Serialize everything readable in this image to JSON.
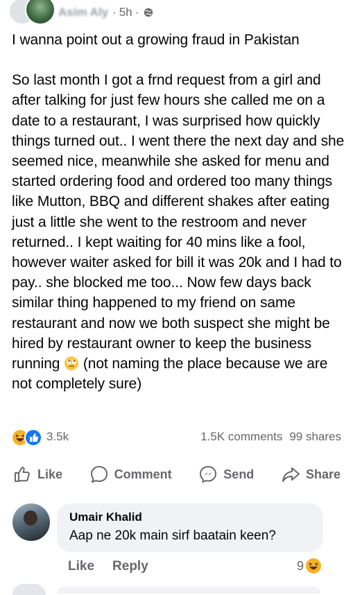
{
  "post": {
    "author": "Asim Aly",
    "time": "5h",
    "separator": "·",
    "paragraphs": [
      "I wanna point out a growing fraud in Pakistan",
      "So last month I got a frnd request from a girl and after talking for just few hours she called me on a date to a restaurant, I was surprised how quickly things turned out.. I went there the next day and she seemed nice, meanwhile she asked for menu and started ordering food and ordered too many things like Mutton, BBQ and different shakes after eating just a little she went to the restroom and never returned.. I kept waiting for 40 mins like a fool, however waiter asked for bill it was 20k and I had to pay.. she blocked me too... Now few days back similar thing happened to my friend on same restaurant and now we both suspect she might be hired by restaurant owner to keep the business running"
    ],
    "paragraph_tail": "(not naming the place because we are not completely sure)",
    "inline_emoji": "rolling-eyes-emoji"
  },
  "reactions": {
    "count": "3.5k",
    "comments": "1.5K comments",
    "shares": "99 shares",
    "icons": [
      "haha-reaction",
      "like-reaction"
    ]
  },
  "actions": {
    "like": "Like",
    "comment": "Comment",
    "send": "Send",
    "share": "Share"
  },
  "comment": {
    "author": "Umair Khalid",
    "text": "Aap ne 20k main sirf baatain keen?",
    "like": "Like",
    "reply": "Reply",
    "reaction_count": "9"
  },
  "colors": {
    "text": "#050505",
    "secondary": "#65676b",
    "bubble": "#f0f2f5",
    "like_blue": "#1877f2",
    "haha_yellow": "#f7b125"
  }
}
